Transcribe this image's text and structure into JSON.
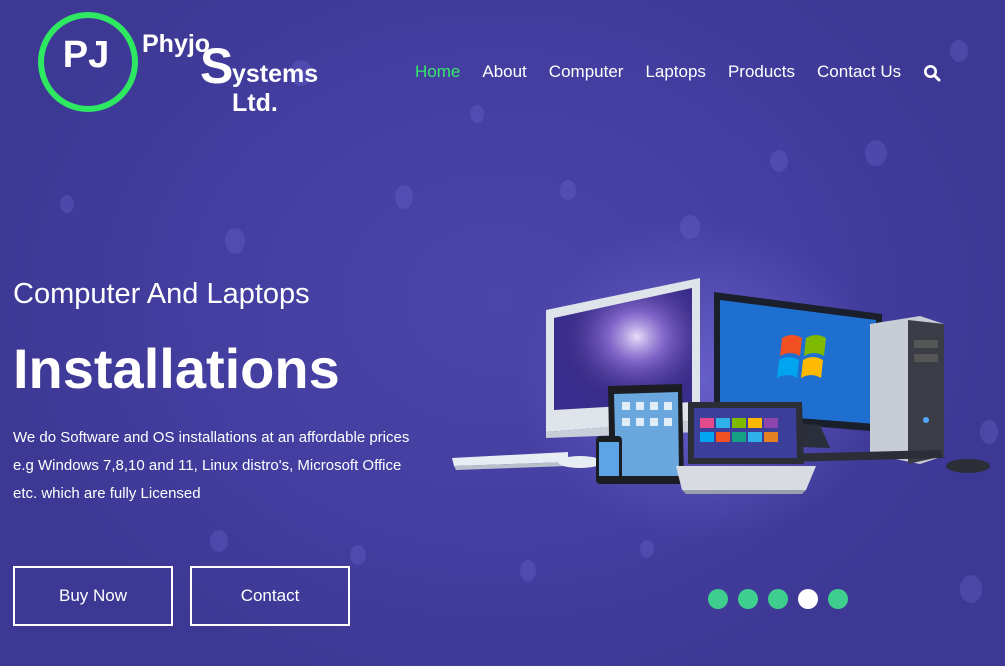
{
  "brand": {
    "initials": "PJ",
    "name_part1": "Phyjo",
    "name_big_letter": "S",
    "name_part2": "ystems Ltd."
  },
  "nav": {
    "items": [
      {
        "label": "Home",
        "active": true
      },
      {
        "label": "About",
        "active": false
      },
      {
        "label": "Computer",
        "active": false
      },
      {
        "label": "Laptops",
        "active": false
      },
      {
        "label": "Products",
        "active": false
      },
      {
        "label": "Contact Us",
        "active": false
      }
    ],
    "search_icon": "search-icon"
  },
  "hero": {
    "subtitle": "Computer And Laptops",
    "headline": "Installations",
    "description_lines": [
      "We do Software and OS installations at an affordable prices",
      "e.g Windows 7,8,10 and 11, Linux distro's, Microsoft Office",
      "etc. which are fully Licensed"
    ],
    "buy_label": "Buy Now",
    "contact_label": "Contact"
  },
  "slider": {
    "slide_count": 5,
    "active_slide": 4
  },
  "colors": {
    "background": "#433ea0",
    "accent_green": "#35e86a",
    "dot_green": "#3ecf8e"
  }
}
